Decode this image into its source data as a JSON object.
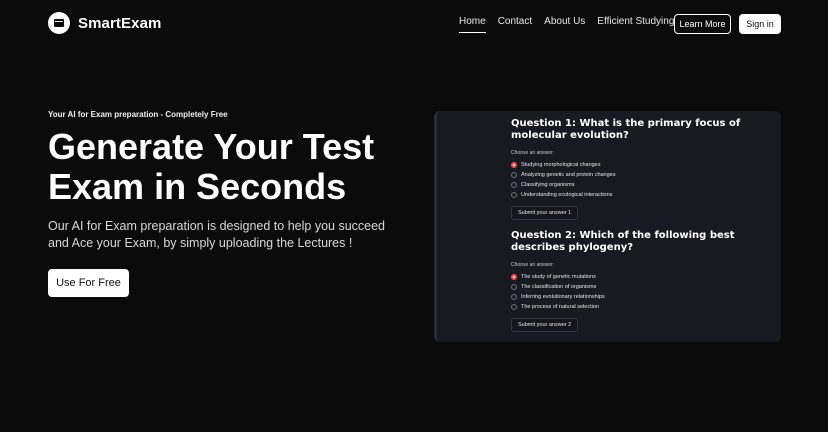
{
  "brand": {
    "name": "SmartExam",
    "icon": "exam-screen-icon"
  },
  "nav": {
    "items": [
      {
        "label": "Home",
        "active": true
      },
      {
        "label": "Contact",
        "active": false
      },
      {
        "label": "About Us",
        "active": false
      },
      {
        "label": "Efficient Studying",
        "active": false
      }
    ],
    "learn_more": "Learn More",
    "sign_in": "Sign in"
  },
  "hero": {
    "eyebrow": "Your AI for Exam preparation - Completely Free",
    "title": "Generate Your Test Exam in Seconds",
    "description": "Our AI for Exam preparation is designed to help you succeed and Ace your Exam, by simply uploading the Lectures !",
    "cta": "Use For Free"
  },
  "quiz": {
    "questions": [
      {
        "title": "Question 1: What is the primary focus of molecular evolution?",
        "prompt": "Choose an answer:",
        "options": [
          "Studying morphological changes",
          "Analyzing genetic and protein changes",
          "Classifying organisms",
          "Understanding ecological interactions"
        ],
        "selected_index": 0,
        "submit": "Submit your answer 1"
      },
      {
        "title": "Question 2: Which of the following best describes phylogeny?",
        "prompt": "Choose an answer:",
        "options": [
          "The study of genetic mutations",
          "The classification of organisms",
          "Inferring evolutionary relationships",
          "The process of natural selection"
        ],
        "selected_index": 0,
        "submit": "Submit your answer 2"
      }
    ]
  },
  "colors": {
    "background": "#0b0b0b",
    "panel": "#181a21",
    "radio_selected": "#ff4b4b",
    "text": "#ffffff"
  }
}
